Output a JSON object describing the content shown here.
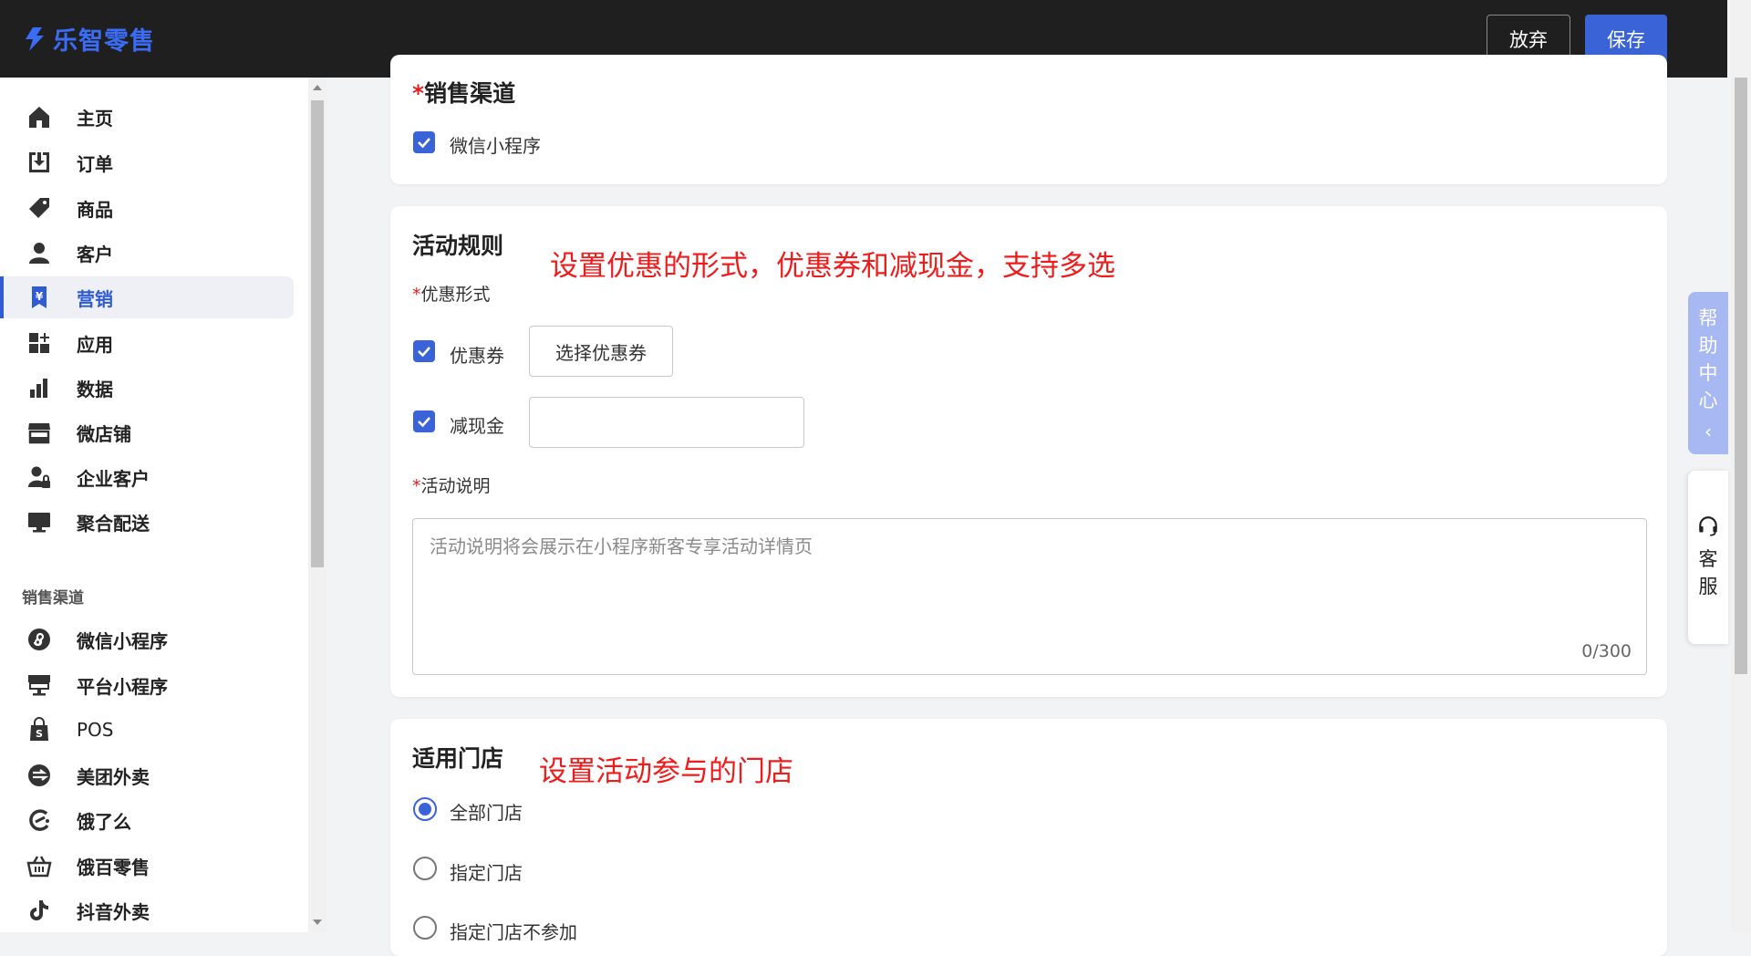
{
  "app": {
    "logo_text": "乐智零售",
    "brand_color": "#3b6cf6"
  },
  "topbar": {
    "discard_label": "放弃",
    "save_label": "保存"
  },
  "sidebar": {
    "items": [
      {
        "label": "主页",
        "icon": "home-icon"
      },
      {
        "label": "订单",
        "icon": "inbox-download-icon"
      },
      {
        "label": "商品",
        "icon": "tag-icon"
      },
      {
        "label": "客户",
        "icon": "person-icon"
      },
      {
        "label": "营销",
        "icon": "yen-bookmark-icon",
        "active": true
      },
      {
        "label": "应用",
        "icon": "apps-add-icon"
      },
      {
        "label": "数据",
        "icon": "bar-chart-icon"
      },
      {
        "label": "微店铺",
        "icon": "storefront-icon"
      },
      {
        "label": "企业客户",
        "icon": "person-lock-icon"
      },
      {
        "label": "聚合配送",
        "icon": "monitor-icon"
      }
    ],
    "channels_label": "销售渠道",
    "channels": [
      {
        "label": "微信小程序",
        "icon": "mini-program-icon"
      },
      {
        "label": "平台小程序",
        "icon": "kiosk-icon"
      },
      {
        "label": "POS",
        "icon": "shopping-bag-icon"
      },
      {
        "label": "美团外卖",
        "icon": "meituan-icon"
      },
      {
        "label": "饿了么",
        "icon": "eleme-icon"
      },
      {
        "label": "饿百零售",
        "icon": "basket-icon"
      },
      {
        "label": "抖音外卖",
        "icon": "tiktok-icon"
      }
    ]
  },
  "sales_channel": {
    "title": "销售渠道",
    "required_mark": "*",
    "option_label": "微信小程序",
    "option_checked": true
  },
  "activity_rules": {
    "title": "活动规则",
    "annotation": "设置优惠的形式，优惠券和减现金，支持多选",
    "discount_form_label": "优惠形式",
    "required_mark": "*",
    "coupon_label": "优惠券",
    "coupon_checked": true,
    "select_coupon_button": "选择优惠券",
    "cash_label": "减现金",
    "cash_checked": true,
    "cash_value": "",
    "description_label": "活动说明",
    "description_placeholder": "活动说明将会展示在小程序新客专享活动详情页",
    "char_count": "0/300"
  },
  "stores": {
    "title": "适用门店",
    "annotation": "设置活动参与的门店",
    "options": [
      {
        "label": "全部门店",
        "selected": true
      },
      {
        "label": "指定门店",
        "selected": false
      },
      {
        "label": "指定门店不参加",
        "selected": false
      }
    ]
  },
  "floating": {
    "help_chars": [
      "帮",
      "助",
      "中",
      "心"
    ],
    "service_chars": [
      "客",
      "服"
    ]
  },
  "colors": {
    "primary": "#3b63d8",
    "annotation": "#ee1c1c",
    "topbar": "#1f1f1f"
  }
}
